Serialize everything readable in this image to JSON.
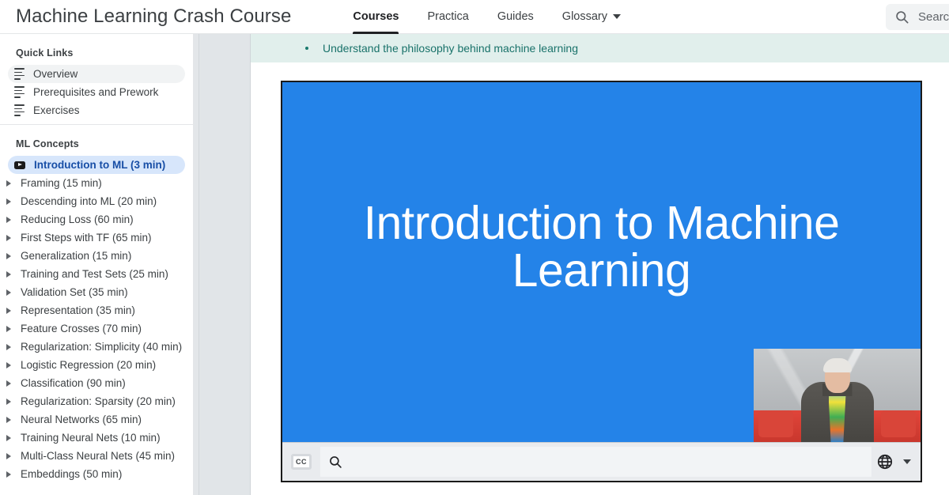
{
  "header": {
    "brand": "Machine Learning Crash Course",
    "nav": [
      {
        "label": "Courses",
        "active": true,
        "caret": false
      },
      {
        "label": "Practica",
        "active": false,
        "caret": false
      },
      {
        "label": "Guides",
        "active": false,
        "caret": false
      },
      {
        "label": "Glossary",
        "active": false,
        "caret": true
      }
    ],
    "search": {
      "icon": "search-icon",
      "placeholder": "Search",
      "value": ""
    }
  },
  "sidebar": {
    "quick_links": {
      "title": "Quick Links",
      "items": [
        {
          "label": "Overview",
          "icon": "list-icon",
          "selected": true
        },
        {
          "label": "Prerequisites and Prework",
          "icon": "list-icon",
          "selected": false
        },
        {
          "label": "Exercises",
          "icon": "list-icon",
          "selected": false
        }
      ]
    },
    "ml_concepts": {
      "title": "ML Concepts",
      "video_item": {
        "label": "Introduction to ML (3 min)",
        "icon": "youtube-icon",
        "active": true
      },
      "items": [
        {
          "label": "Framing (15 min)"
        },
        {
          "label": "Descending into ML (20 min)"
        },
        {
          "label": "Reducing Loss (60 min)"
        },
        {
          "label": "First Steps with TF (65 min)"
        },
        {
          "label": "Generalization (15 min)"
        },
        {
          "label": "Training and Test Sets (25 min)"
        },
        {
          "label": "Validation Set (35 min)"
        },
        {
          "label": "Representation (35 min)"
        },
        {
          "label": "Feature Crosses (70 min)"
        },
        {
          "label": "Regularization: Simplicity (40 min)"
        },
        {
          "label": "Logistic Regression (20 min)"
        },
        {
          "label": "Classification (90 min)"
        },
        {
          "label": "Regularization: Sparsity (20 min)"
        },
        {
          "label": "Neural Networks (65 min)"
        },
        {
          "label": "Training Neural Nets (10 min)"
        },
        {
          "label": "Multi-Class Neural Nets (45 min)"
        },
        {
          "label": "Embeddings (50 min)"
        }
      ]
    }
  },
  "main": {
    "objective": {
      "bullet_text": "Understand the philosophy behind machine learning"
    },
    "video": {
      "title_line1": "Introduction to Machine",
      "title_line2": "Learning",
      "background_color": "#2483e8",
      "controls": {
        "cc_label": "CC",
        "search_icon": "search-icon",
        "search_placeholder": "",
        "search_value": "",
        "language_icon": "globe-icon",
        "language_caret_icon": "chevron-down-icon"
      }
    }
  },
  "colors": {
    "video_blue": "#2483e8",
    "banner_green": "#e1efec",
    "banner_text": "#19726a",
    "active_item_blue": "#d7e6fb",
    "active_item_text": "#174ea6"
  }
}
